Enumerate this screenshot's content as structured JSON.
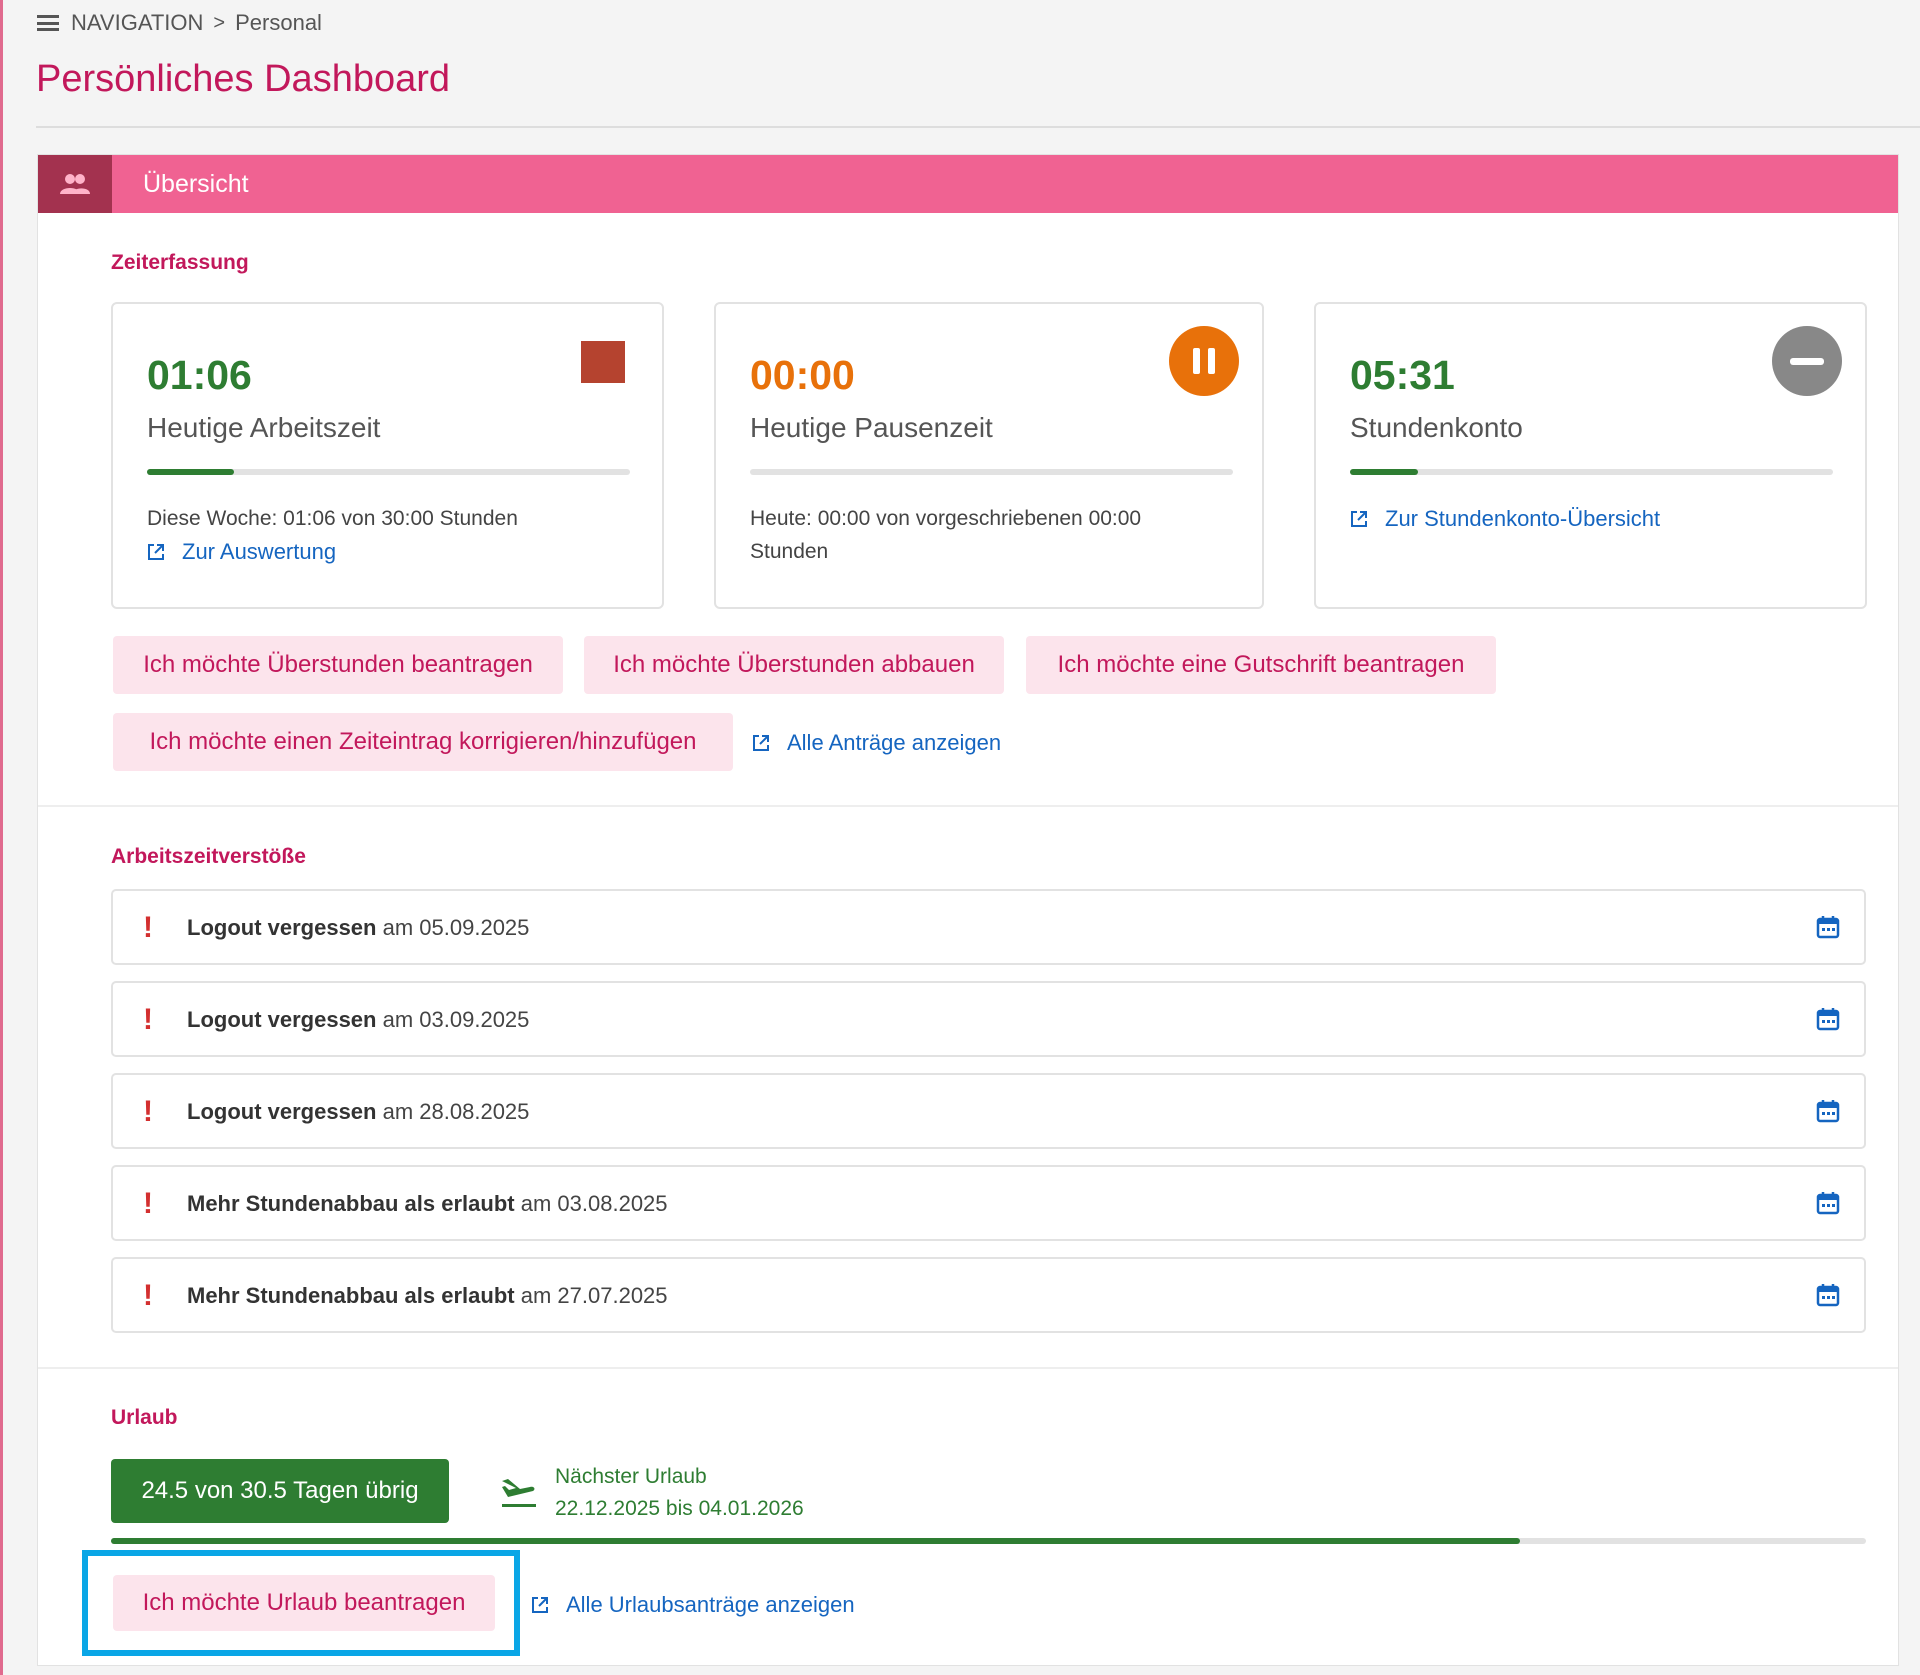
{
  "breadcrumb": {
    "root": "NAVIGATION",
    "separator": ">",
    "current": "Personal"
  },
  "page_title": "Persönliches Dashboard",
  "panel": {
    "title": "Übersicht",
    "icon": "people-icon"
  },
  "zeiterfassung": {
    "label": "Zeiterfassung",
    "cards": [
      {
        "value": "01:06",
        "title": "Heutige Arbeitszeit",
        "color": "#2e7d32",
        "progress": 0.18,
        "info": "Diese Woche: 01:06 von 30:00 Stunden",
        "link": "Zur Auswertung",
        "action_icon": "stop-icon"
      },
      {
        "value": "00:00",
        "title": "Heutige Pausenzeit",
        "color": "#e8710a",
        "progress": 0,
        "info": "Heute: 00:00 von vorgeschriebenen 00:00 Stunden",
        "action_icon": "pause-icon"
      },
      {
        "value": "05:31",
        "title": "Stundenkonto",
        "color": "#2e7d32",
        "progress": 0.14,
        "link": "Zur Stundenkonto-Übersicht",
        "action_icon": "minus-icon"
      }
    ],
    "buttons": [
      "Ich möchte Überstunden beantragen",
      "Ich möchte Überstunden abbauen",
      "Ich möchte eine Gutschrift beantragen",
      "Ich möchte einen Zeiteintrag korrigieren/hinzufügen"
    ],
    "all_requests_link": "Alle Anträge anzeigen"
  },
  "violations": {
    "label": "Arbeitszeitverstöße",
    "items": [
      {
        "marker": "!",
        "text": "Logout vergessen",
        "connector": "am",
        "date": "05.09.2025"
      },
      {
        "marker": "!",
        "text": "Logout vergessen",
        "connector": "am",
        "date": "03.09.2025"
      },
      {
        "marker": "!",
        "text": "Logout vergessen",
        "connector": "am",
        "date": "28.08.2025"
      },
      {
        "marker": "!",
        "text": "Mehr Stundenabbau als erlaubt",
        "connector": "am",
        "date": "03.08.2025"
      },
      {
        "marker": "!",
        "text": "Mehr Stundenabbau als erlaubt",
        "connector": "am",
        "date": "27.07.2025"
      }
    ]
  },
  "urlaub": {
    "label": "Urlaub",
    "remaining_badge": "24.5 von 30.5 Tagen übrig",
    "next_label": "Nächster Urlaub",
    "next_range": "22.12.2025 bis 04.01.2026",
    "progress": 0.803,
    "request_button": "Ich möchte Urlaub beantragen",
    "all_link": "Alle Urlaubsanträge anzeigen"
  },
  "colors": {
    "brand": "#c2185b",
    "header": "#f06292",
    "green": "#2e7d32",
    "link": "#1565c0",
    "highlight": "#0aa6e6"
  }
}
